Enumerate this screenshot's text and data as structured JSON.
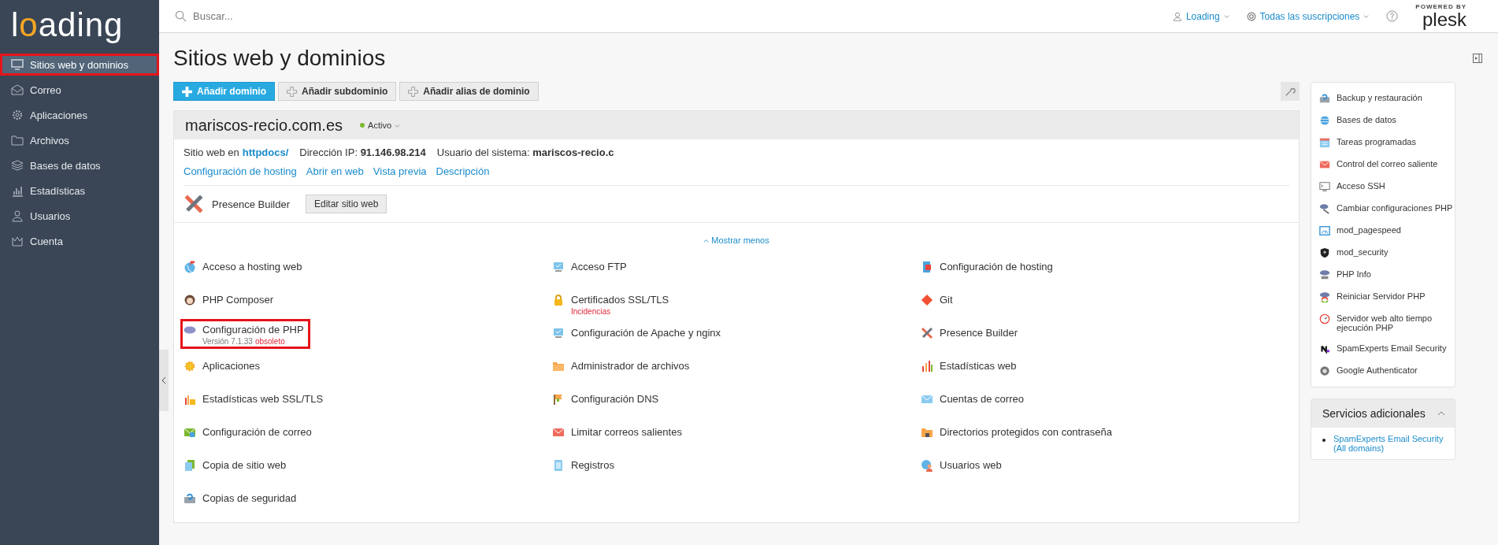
{
  "sidebar": {
    "logo": [
      {
        "text": "l",
        "accent": false
      },
      {
        "text": "o",
        "accent": true
      },
      {
        "text": "ading",
        "accent": false
      }
    ],
    "items": [
      {
        "label": "Sitios web y dominios",
        "selected": true,
        "highlighted": true
      },
      {
        "label": "Correo",
        "selected": false,
        "highlighted": false
      },
      {
        "label": "Aplicaciones",
        "selected": false,
        "highlighted": false
      },
      {
        "label": "Archivos",
        "selected": false,
        "highlighted": false
      },
      {
        "label": "Bases de datos",
        "selected": false,
        "highlighted": false
      },
      {
        "label": "Estadísticas",
        "selected": false,
        "highlighted": false
      },
      {
        "label": "Usuarios",
        "selected": false,
        "highlighted": false
      },
      {
        "label": "Cuenta",
        "selected": false,
        "highlighted": false
      }
    ]
  },
  "topbar": {
    "search": {
      "placeholder": "Buscar..."
    },
    "account": "Loading",
    "subscriptions": "Todas las suscripciones",
    "brand": {
      "caption": "POWERED BY",
      "name": "plesk"
    }
  },
  "page": {
    "title": "Sitios web y dominios"
  },
  "actions": [
    {
      "label": "Añadir dominio",
      "primary": true
    },
    {
      "label": "Añadir subdominio",
      "primary": false
    },
    {
      "label": "Añadir alias de dominio",
      "primary": false
    }
  ],
  "domain": {
    "name": "mariscos-recio.com.es",
    "status": "Activo",
    "info": [
      {
        "kind": "link",
        "label": "Sitio web en",
        "value": "httpdocs/"
      },
      {
        "kind": "text",
        "text": "Dirección IP: **91.146.98.214**"
      },
      {
        "kind": "text",
        "text": "Usuario del sistema: **mariscos-recio.c**"
      }
    ],
    "links": [
      "Configuración de hosting",
      "Abrir en web",
      "Vista previa",
      "Descripción"
    ],
    "builder": {
      "label": "Presence Builder",
      "button": "Editar sitio web"
    },
    "toggle": "Mostrar menos",
    "tools": [
      {
        "label": "Acceso a hosting web",
        "highlighted": false
      },
      {
        "label": "Acceso FTP",
        "highlighted": false
      },
      {
        "label": "Configuración de hosting",
        "highlighted": false
      },
      {
        "label": "PHP Composer",
        "highlighted": false
      },
      {
        "label": "Certificados SSL/TLS",
        "highlighted": false,
        "note": [
          {
            "text": "Incidencias",
            "warning": true
          }
        ]
      },
      {
        "label": "Git",
        "highlighted": false
      },
      {
        "label": "Configuración de PHP",
        "highlighted": true,
        "note": [
          {
            "text": "Versión 7.1.33",
            "warning": false
          },
          {
            "text": "obsoleto",
            "warning": true
          }
        ]
      },
      {
        "label": "Configuración de Apache y nginx",
        "highlighted": false
      },
      {
        "label": "Presence Builder",
        "highlighted": false
      },
      {
        "label": "Aplicaciones",
        "highlighted": false
      },
      {
        "label": "Administrador de archivos",
        "highlighted": false
      },
      {
        "label": "Estadísticas web",
        "highlighted": false
      },
      {
        "label": "Estadísticas web SSL/TLS",
        "highlighted": false
      },
      {
        "label": "Configuración DNS",
        "highlighted": false
      },
      {
        "label": "Cuentas de correo",
        "highlighted": false
      },
      {
        "label": "Configuración de correo",
        "highlighted": false
      },
      {
        "label": "Limitar correos salientes",
        "highlighted": false
      },
      {
        "label": "Directorios protegidos con contraseña",
        "highlighted": false
      },
      {
        "label": "Copia de sitio web",
        "highlighted": false
      },
      {
        "label": "Registros",
        "highlighted": false
      },
      {
        "label": "Usuarios web",
        "highlighted": false
      },
      {
        "label": "Copias de seguridad",
        "highlighted": false
      }
    ]
  },
  "side_tools": [
    "Backup y restauración",
    "Bases de datos",
    "Tareas programadas",
    "Control del correo saliente",
    "Acceso SSH",
    "Cambiar configuraciones PHP",
    "mod_pagespeed",
    "mod_security",
    "PHP Info",
    "Reiniciar Servidor PHP",
    "Servidor web alto tiempo ejecución PHP",
    "SpamExperts Email Security",
    "Google Authenticator"
  ],
  "services": {
    "title": "Servicios adicionales",
    "expanded": true,
    "links": [
      "SpamExperts Email Security (All domains)"
    ]
  }
}
